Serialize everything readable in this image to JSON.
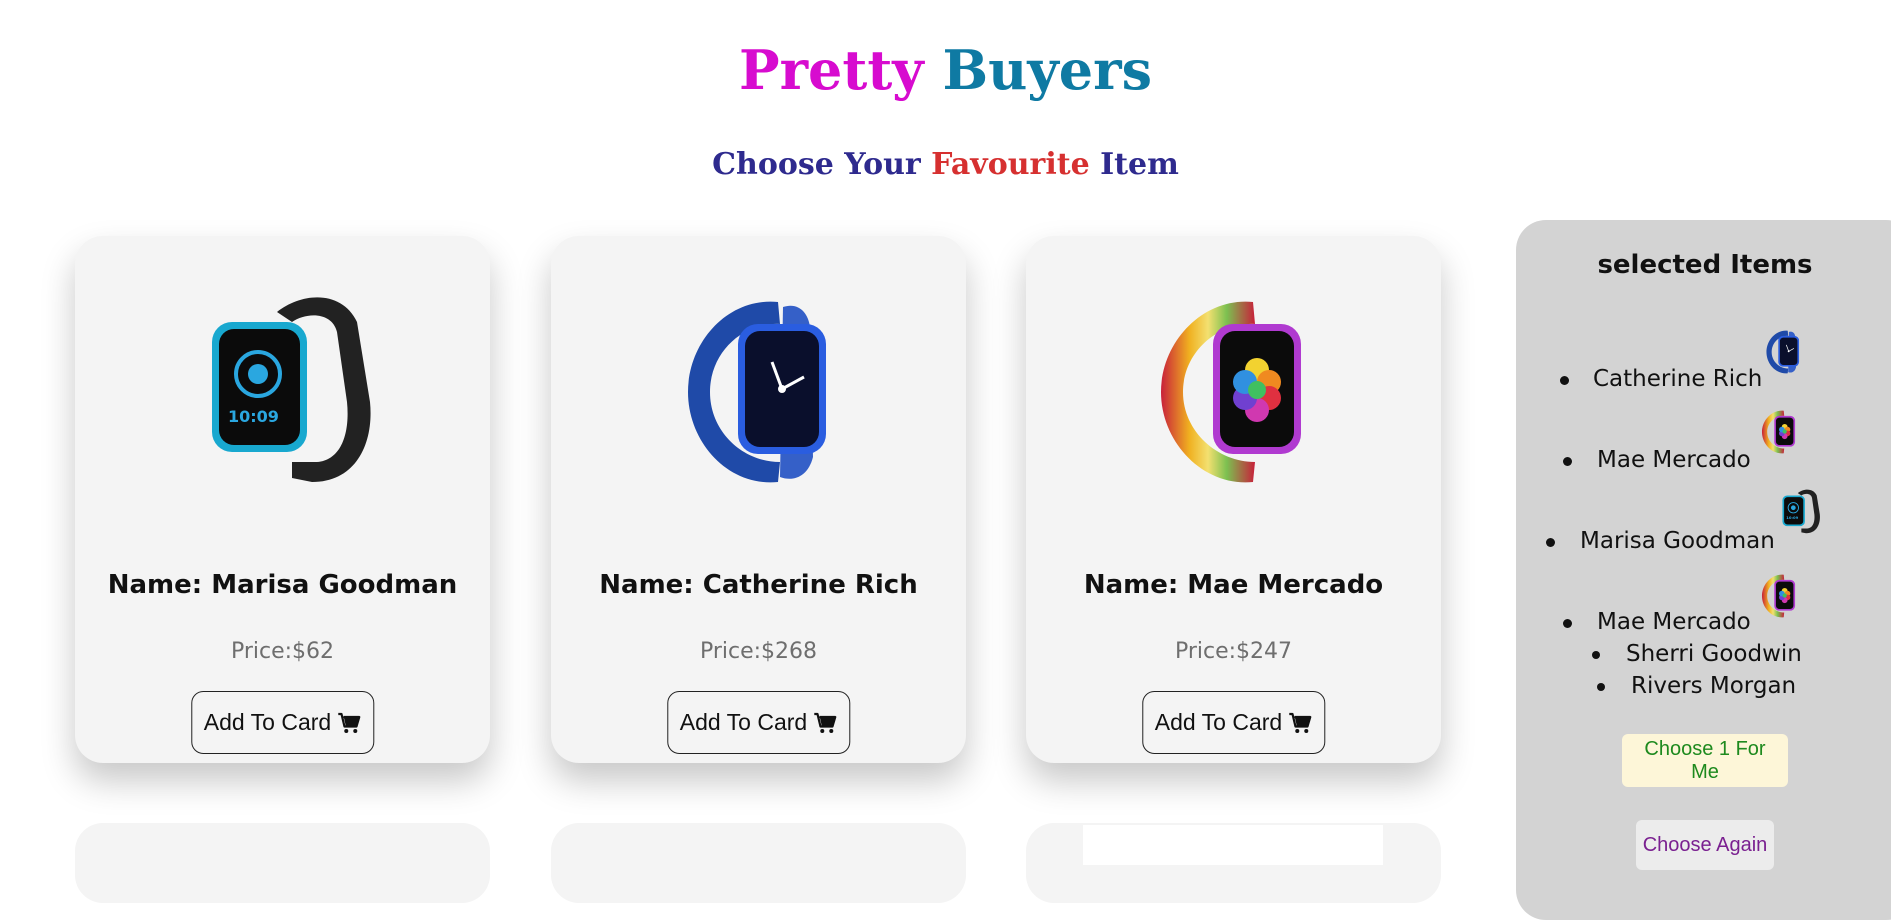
{
  "header": {
    "title_part1": "Pretty",
    "title_part2": "Buyers",
    "subtitle_part1": "Choose Your",
    "subtitle_part2": "Favourite",
    "subtitle_part3": "Item"
  },
  "products": [
    {
      "name": "Name: Marisa Goodman",
      "price": "Price:$62",
      "button": "Add To Card",
      "watch": "teal"
    },
    {
      "name": "Name: Catherine Rich",
      "price": "Price:$268",
      "button": "Add To Card",
      "watch": "blue"
    },
    {
      "name": "Name: Mae Mercado",
      "price": "Price:$247",
      "button": "Add To Card",
      "watch": "rainbow"
    }
  ],
  "selected": {
    "title": "selected Items",
    "items": [
      {
        "name": "Catherine Rich",
        "watch": "blue"
      },
      {
        "name": "Mae Mercado",
        "watch": "rainbow"
      },
      {
        "name": "Marisa Goodman",
        "watch": "teal"
      },
      {
        "name": "Mae Mercado",
        "watch": "rainbow"
      }
    ],
    "nested": [
      "Sherri Goodwin",
      "Rivers Morgan"
    ],
    "choose_button": "Choose 1 For Me",
    "again_button": "Choose Again"
  },
  "icons": {
    "cart": "cart-icon"
  },
  "colors": {
    "title_pink": "#d70bcf",
    "title_teal": "#0f7aa3",
    "subtitle_navy": "#2e2a8e",
    "subtitle_red": "#d63030",
    "card_bg": "#f4f4f4",
    "panel_bg": "#d3d3d3",
    "choose_text": "#1e8a1e",
    "again_text": "#7a2090"
  }
}
